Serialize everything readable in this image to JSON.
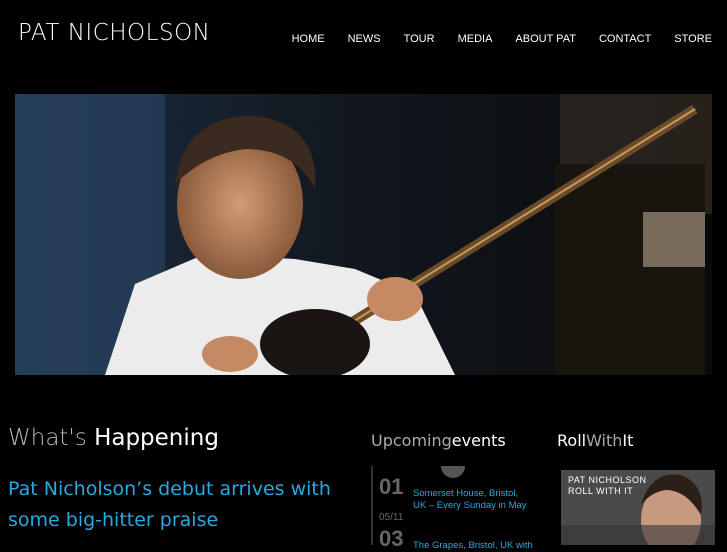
{
  "header": {
    "logo": "PAT NICHOLSON",
    "nav": [
      "HOME",
      "NEWS",
      "TOUR",
      "MEDIA",
      "ABOUT PAT",
      "CONTACT",
      "STORE"
    ]
  },
  "hero": {
    "alt_subject": "hero-photo"
  },
  "whats_happening": {
    "title_light": "What's",
    "title_bold": "Happening",
    "headline": "Pat Nicholson’s debut arrives with some big-hitter praise"
  },
  "upcoming": {
    "title_light": "Upcoming",
    "title_bold": "events",
    "events": [
      {
        "num": "01",
        "date": "05/11",
        "desc": "Somerset House, Bristol, UK – Every Sunday in May"
      },
      {
        "num": "03",
        "date": "",
        "desc": "The Grapes, Bristol, UK with"
      }
    ]
  },
  "roll": {
    "title_bold": "Roll",
    "title_light": "With",
    "title_end": "It",
    "album_line1": "PAT NICHOLSON",
    "album_line2": "ROLL WITH IT"
  },
  "colors": {
    "accent": "#2aa8e0",
    "background": "#000000"
  }
}
